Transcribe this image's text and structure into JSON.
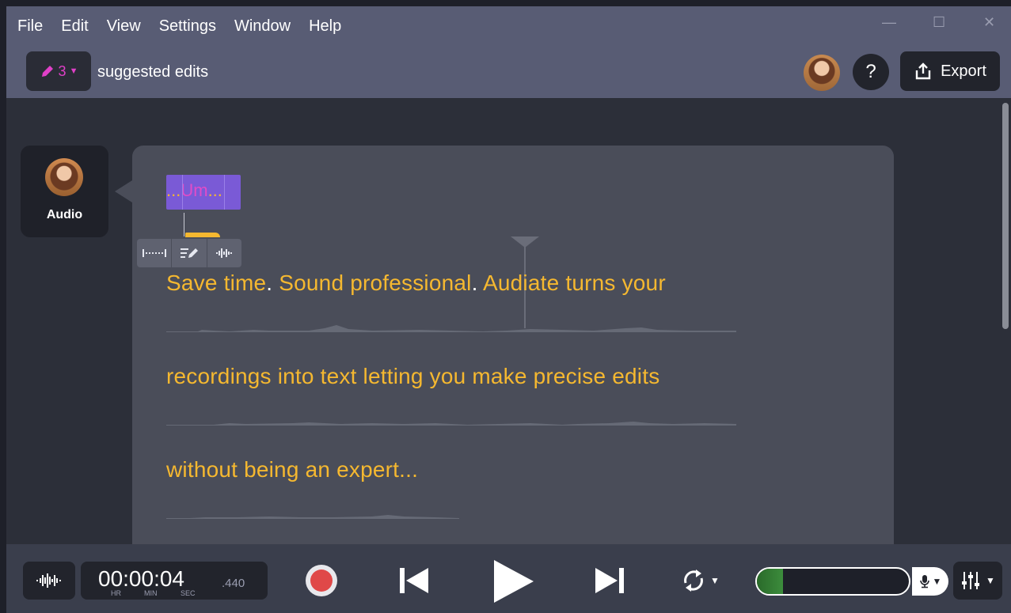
{
  "menu": {
    "items": [
      "File",
      "Edit",
      "View",
      "Settings",
      "Window",
      "Help"
    ]
  },
  "window_controls": {
    "minimize": "—",
    "maximize": "☐",
    "close": "✕"
  },
  "toolbar": {
    "edits_count": "3",
    "edits_label": "suggested edits",
    "help_label": "?",
    "export_label": "Export"
  },
  "speaker": {
    "name": "Audio"
  },
  "transcript": {
    "filler": {
      "dots_before": "...",
      "word": "Um",
      "dots_after": "..."
    },
    "line1": {
      "a": "Save time",
      "p1": ".",
      "b": " Sound professional",
      "p2": ".",
      "c": " Audiate turns your"
    },
    "line2": "recordings into text letting you make precise edits",
    "line3": "without being an expert..."
  },
  "transport": {
    "timecode": "00:00:04",
    "milliseconds": ".440",
    "unit_hr": "HR",
    "unit_min": "MIN",
    "unit_sec": "SEC",
    "input_level": 0.17
  },
  "colors": {
    "accent_transcript": "#f5b830",
    "filler_highlight": "#7a5ad6",
    "filler_text": "#e14cc8",
    "record": "#e04848",
    "meter": "#3c8c3c"
  }
}
